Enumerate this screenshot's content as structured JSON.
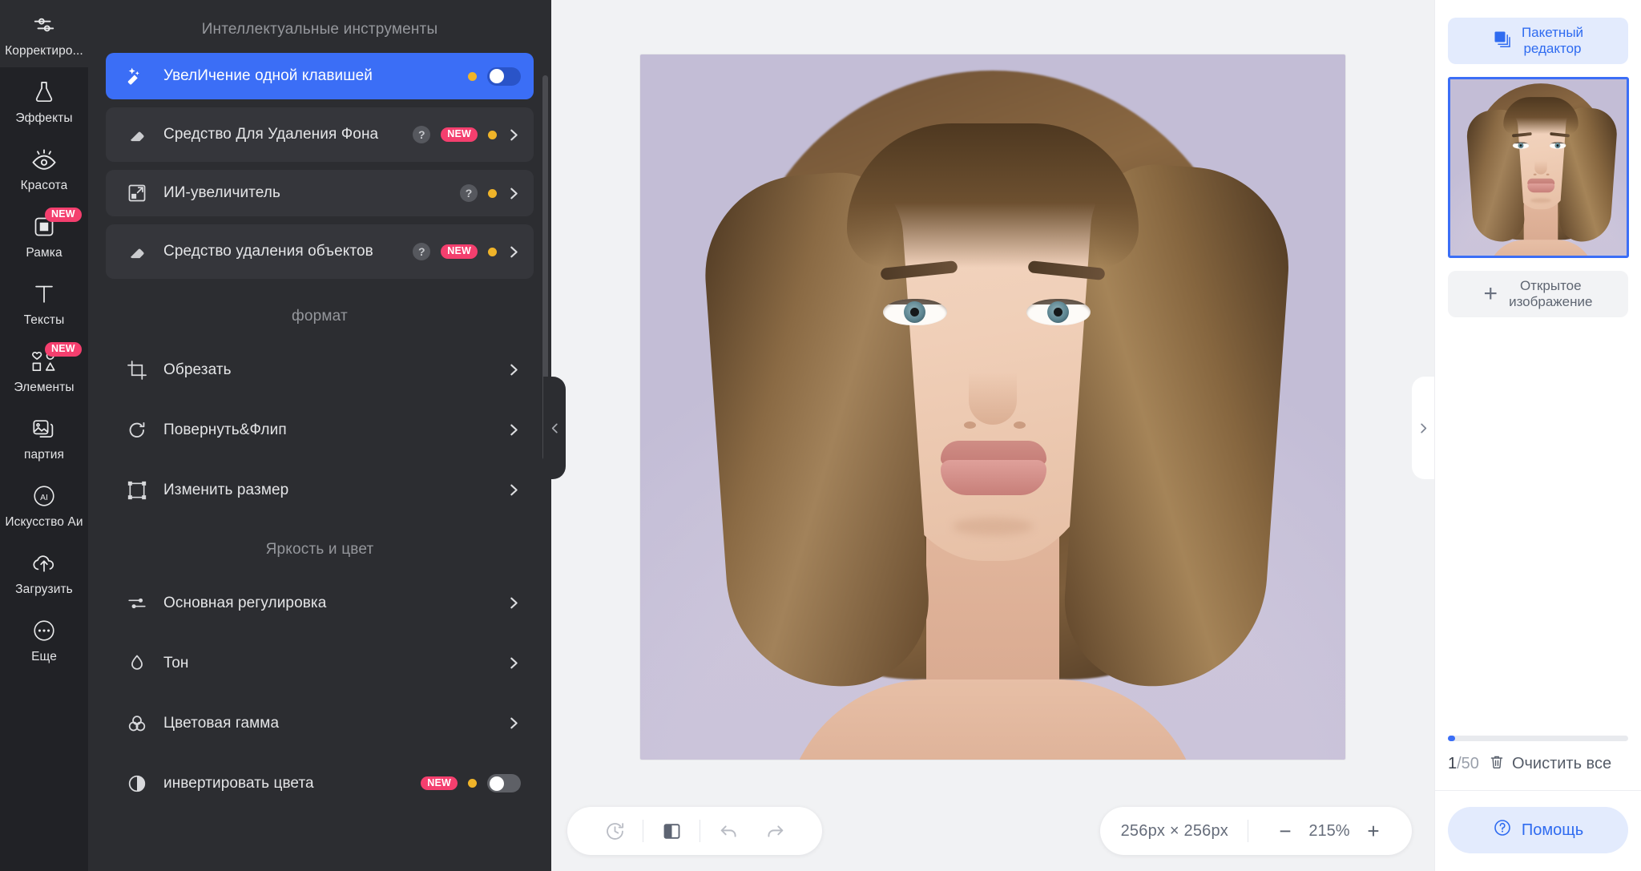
{
  "rail": {
    "items": [
      {
        "label": "Корректиро...",
        "icon": "sliders-icon",
        "active": true,
        "badge": null
      },
      {
        "label": "Эффекты",
        "icon": "flask-icon",
        "active": false,
        "badge": null
      },
      {
        "label": "Красота",
        "icon": "eye-icon",
        "active": false,
        "badge": null
      },
      {
        "label": "Рамка",
        "icon": "frame-icon",
        "active": false,
        "badge": "NEW"
      },
      {
        "label": "Тексты",
        "icon": "text-icon",
        "active": false,
        "badge": null
      },
      {
        "label": "Элементы",
        "icon": "shapes-icon",
        "active": false,
        "badge": "NEW"
      },
      {
        "label": "партия",
        "icon": "stack-images-icon",
        "active": false,
        "badge": null
      },
      {
        "label": "Искусство Аи",
        "icon": "ai-circle-icon",
        "active": false,
        "badge": null
      },
      {
        "label": "Загрузить",
        "icon": "cloud-upload-icon",
        "active": false,
        "badge": null
      },
      {
        "label": "Еще",
        "icon": "ellipsis-circle-icon",
        "active": false,
        "badge": null
      }
    ]
  },
  "panel": {
    "sections": [
      {
        "title": "Интеллектуальные инструменты",
        "items": [
          {
            "label": "УвелИчение одной клавишей",
            "icon": "magic-wand-icon",
            "active": true,
            "help": false,
            "badge": null,
            "dot": true,
            "control": "toggle-on"
          },
          {
            "label": "Средство Для Удаления Фона",
            "icon": "eraser-icon",
            "active": false,
            "help": true,
            "badge": "NEW",
            "dot": true,
            "control": "chevron"
          },
          {
            "label": "ИИ-увеличитель",
            "icon": "upscale-icon",
            "active": false,
            "help": true,
            "badge": null,
            "dot": true,
            "control": "chevron"
          },
          {
            "label": "Средство удаления объектов",
            "icon": "eraser-icon",
            "active": false,
            "help": true,
            "badge": "NEW",
            "dot": true,
            "control": "chevron"
          }
        ]
      },
      {
        "title": "формат",
        "items": [
          {
            "label": "Обрезать",
            "icon": "crop-icon",
            "active": false,
            "help": false,
            "badge": null,
            "dot": false,
            "control": "chevron"
          },
          {
            "label": "Повернуть&Флип",
            "icon": "rotate-icon",
            "active": false,
            "help": false,
            "badge": null,
            "dot": false,
            "control": "chevron"
          },
          {
            "label": "Изменить размер",
            "icon": "resize-icon",
            "active": false,
            "help": false,
            "badge": null,
            "dot": false,
            "control": "chevron"
          }
        ]
      },
      {
        "title": "Яркость и цвет",
        "items": [
          {
            "label": "Основная регулировка",
            "icon": "sliders-icon",
            "active": false,
            "help": false,
            "badge": null,
            "dot": false,
            "control": "chevron"
          },
          {
            "label": "Тон",
            "icon": "droplet-icon",
            "active": false,
            "help": false,
            "badge": null,
            "dot": false,
            "control": "chevron"
          },
          {
            "label": "Цветовая гамма",
            "icon": "color-circles-icon",
            "active": false,
            "help": false,
            "badge": null,
            "dot": false,
            "control": "chevron"
          },
          {
            "label": "инвертировать цвета",
            "icon": "contrast-icon",
            "active": false,
            "help": false,
            "badge": "NEW",
            "dot": true,
            "control": "toggle-off"
          }
        ]
      }
    ]
  },
  "canvas": {
    "collapse_left": "‹",
    "collapse_right": "›",
    "toolbar": {
      "history_icon": "history-clock-icon",
      "compare_icon": "compare-split-icon",
      "undo_icon": "undo-arrow-icon",
      "redo_icon": "redo-arrow-icon"
    },
    "zoombar": {
      "dimensions": "256px × 256px",
      "minus_label": "−",
      "zoom_level": "215%",
      "plus_label": "+"
    }
  },
  "right": {
    "batch_label": "Пакетный\nредактор",
    "batch_line1": "Пакетный",
    "batch_line2": "редактор",
    "batch_icon": "stack-squares-icon",
    "thumbnail_name": "image-thumbnail",
    "open_line1": "Открытое",
    "open_line2": "изображение",
    "open_plus": "+",
    "count": "1/50",
    "count_current": "1",
    "count_total": "/50",
    "clear_all": "Очистить все",
    "trash_icon": "trash-icon",
    "help_label": "Помощь",
    "help_icon": "question-circle-icon"
  },
  "colors": {
    "accent_blue": "#3b6ef6",
    "badge_pink": "#f43f6e",
    "dot_orange": "#f0b429",
    "panel_bg": "#2c2d31",
    "rail_bg": "#212226",
    "canvas_bg": "#f1f2f4"
  }
}
